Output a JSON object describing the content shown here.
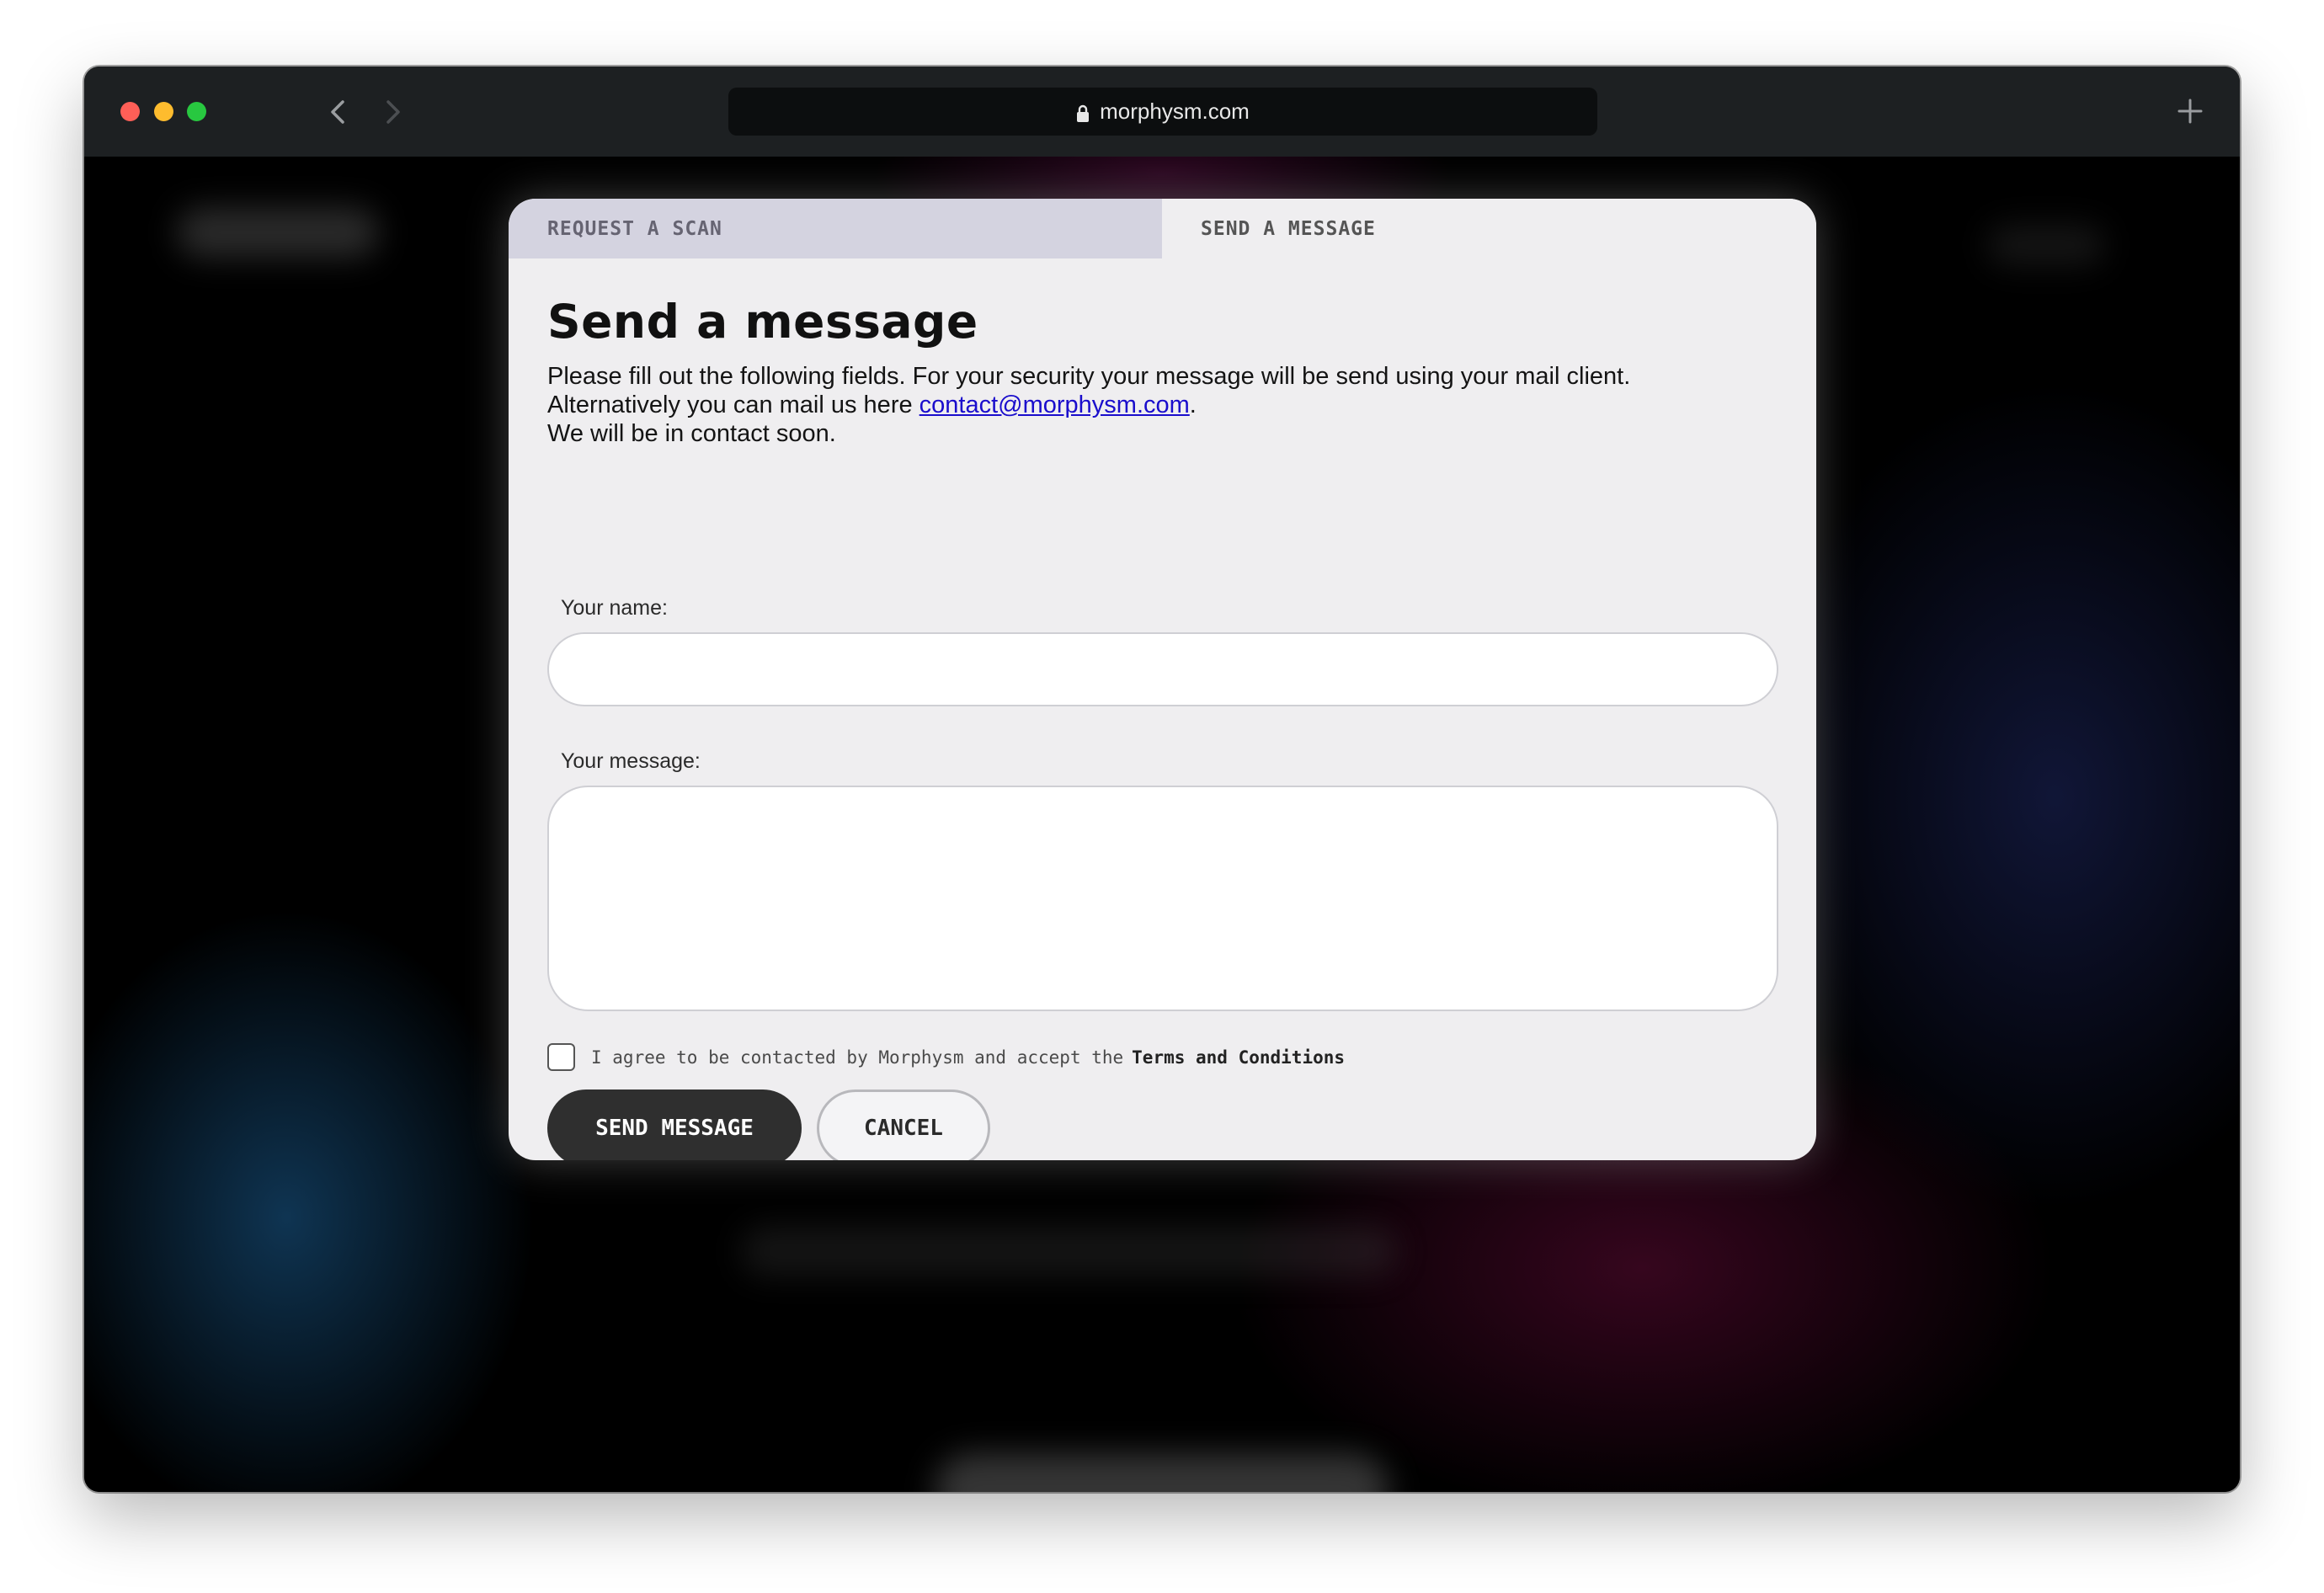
{
  "browser": {
    "url": "morphysm.com"
  },
  "tabs": {
    "request_scan": "REQUEST A SCAN",
    "send_message": "SEND A MESSAGE"
  },
  "form": {
    "heading": "Send a message",
    "description_line1": "Please fill out the following fields. For your security your message will be send using your mail client.",
    "description_line2_prefix": "Alternatively you can mail us here ",
    "email_link": "contact@morphysm.com",
    "description_line2_suffix": ".",
    "description_line3": "We will be in contact soon.",
    "name_label": "Your name:",
    "name_value": "",
    "message_label": "Your message:",
    "message_value": "",
    "consent_text": "I agree to be contacted by Morphysm and accept the",
    "consent_terms": "Terms and Conditions",
    "send_button": "SEND MESSAGE",
    "cancel_button": "CANCEL"
  },
  "colors": {
    "traffic_red": "#ff5f57",
    "traffic_yellow": "#febc2e",
    "traffic_green": "#28c840",
    "tab_inactive_bg": "#d4d3e0",
    "modal_bg": "#efeef0",
    "send_button_bg": "#2f2f2f",
    "link": "#1a0dcc"
  }
}
